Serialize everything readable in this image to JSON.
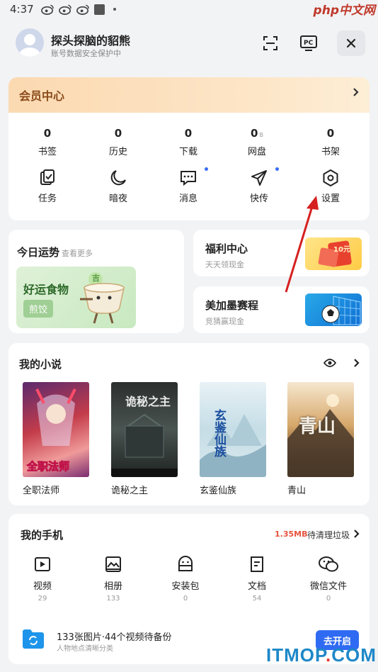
{
  "status_bar": {
    "time": "4:37",
    "icons": [
      "weibo-icon",
      "weibo-icon",
      "weibo-icon",
      "square-icon",
      "dot-icon"
    ]
  },
  "watermark": {
    "php": "php中文网",
    "itmop_prefix": "ITMOP",
    "itmop_dot": ".",
    "itmop_suffix": "COM"
  },
  "header": {
    "username": "探头探脑的貂熊",
    "subtitle": "账号数据安全保护中",
    "buttons": [
      "scan-icon",
      "pc-icon",
      "close-icon"
    ],
    "pc_label": "PC"
  },
  "member": {
    "title": "会员中心",
    "stats": [
      {
        "num": "0",
        "unit": "",
        "label": "书签"
      },
      {
        "num": "0",
        "unit": "",
        "label": "历史"
      },
      {
        "num": "0",
        "unit": "",
        "label": "下载"
      },
      {
        "num": "0",
        "unit": "B",
        "label": "网盘"
      },
      {
        "num": "0",
        "unit": "",
        "label": "书架"
      }
    ],
    "tools": [
      {
        "label": "任务",
        "icon": "task-icon",
        "dot": false
      },
      {
        "label": "暗夜",
        "icon": "moon-icon",
        "dot": false
      },
      {
        "label": "消息",
        "icon": "message-icon",
        "dot": true
      },
      {
        "label": "快传",
        "icon": "send-icon",
        "dot": true
      },
      {
        "label": "设置",
        "icon": "settings-icon",
        "dot": false
      }
    ]
  },
  "fortune": {
    "title": "今日运势",
    "more": "查看更多",
    "food_title": "好运食物",
    "food_tag": "煎饺",
    "badge": "吉"
  },
  "welfare": {
    "title": "福利中心",
    "sub": "天天领现金",
    "badge": "10元"
  },
  "match": {
    "title": "美加墨赛程",
    "sub": "竞猜赢现金"
  },
  "novels": {
    "title": "我的小说",
    "books": [
      {
        "name": "全职法师",
        "cover_text": "全职法师"
      },
      {
        "name": "诡秘之主",
        "cover_text": "诡秘之主"
      },
      {
        "name": "玄鉴仙族",
        "cover_text": "玄鉴仙族"
      },
      {
        "name": "青山",
        "cover_text": "青山"
      }
    ]
  },
  "phone": {
    "title": "我的手机",
    "size": "1.35MB",
    "clean_label": "待清理垃圾",
    "items": [
      {
        "label": "视频",
        "count": "29",
        "icon": "video-icon"
      },
      {
        "label": "相册",
        "count": "133",
        "icon": "album-icon"
      },
      {
        "label": "安装包",
        "count": "0",
        "icon": "package-icon"
      },
      {
        "label": "文档",
        "count": "54",
        "icon": "document-icon"
      },
      {
        "label": "微信文件",
        "count": "0",
        "icon": "wechat-icon"
      }
    ],
    "backup_title": "133张图片·44个视频待备份",
    "backup_sub": "人物地点清晰分类",
    "backup_button": "去开启"
  },
  "colors": {
    "accent": "#2f6bf2",
    "member_title": "#8a4b1a",
    "arrow": "#d62020"
  }
}
